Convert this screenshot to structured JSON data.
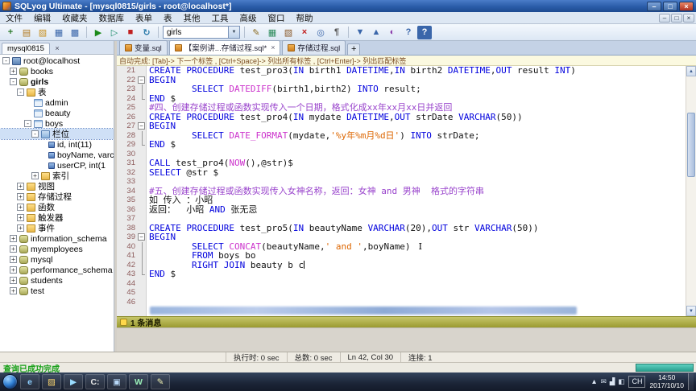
{
  "glyphs": {
    "min": "–",
    "max": "□",
    "close": "×",
    "dropdown": "▼",
    "up": "▲",
    "down": "▼",
    "fold_minus": "−"
  },
  "window": {
    "title": "SQLyog Ultimate - [mysql0815/girls - root@localhost*]"
  },
  "menubar": {
    "items": [
      "文件",
      "编辑",
      "收藏夹",
      "数据库",
      "表单",
      "表",
      "其他",
      "工具",
      "高级",
      "窗口",
      "帮助"
    ]
  },
  "toolbar": {
    "db_value": "girls",
    "items": [
      {
        "name": "new-connection-icon",
        "g": "+",
        "c": "#2a7a2a"
      },
      {
        "name": "new-query-editor-icon",
        "g": "▤",
        "c": "#b07820"
      },
      {
        "name": "open-file-icon",
        "g": "▨",
        "c": "#c89020"
      },
      {
        "name": "save-file-icon",
        "g": "▦",
        "c": "#3a66aa"
      },
      {
        "name": "save-all-icon",
        "g": "▩",
        "c": "#3a66aa"
      },
      {
        "sep": true
      },
      {
        "name": "execute-query-icon",
        "g": "▶",
        "c": "#1a8a1a"
      },
      {
        "name": "explain-query-icon",
        "g": "▷",
        "c": "#1a8a6a"
      },
      {
        "name": "stop-query-icon",
        "g": "■",
        "c": "#c02020"
      },
      {
        "name": "refresh-icon",
        "g": "↻",
        "c": "#2a7aaa"
      },
      {
        "sep": true
      },
      {
        "combo": true
      },
      {
        "sep": true
      },
      {
        "name": "insert-update-icon",
        "g": "✎",
        "c": "#8a6a20"
      },
      {
        "name": "new-table-icon",
        "g": "▦",
        "c": "#2a8a5a"
      },
      {
        "name": "alter-table-icon",
        "g": "▧",
        "c": "#8a5a2a"
      },
      {
        "name": "delete-icon",
        "g": "×",
        "c": "#c02020"
      },
      {
        "name": "find-icon",
        "g": "◎",
        "c": "#3a66aa"
      },
      {
        "name": "format-query-icon",
        "g": "¶",
        "c": "#555555"
      },
      {
        "sep": true
      },
      {
        "name": "export-icon",
        "g": "▼",
        "c": "#3a66aa"
      },
      {
        "name": "import-icon",
        "g": "▲",
        "c": "#3a66aa"
      },
      {
        "name": "scheduler-icon",
        "g": "◐",
        "c": "#8a3aaa"
      },
      {
        "name": "info-icon",
        "g": "?",
        "c": "#3a66aa"
      },
      {
        "name": "help-icon",
        "g": "?",
        "c": "#ffffff",
        "bg": "#3a66aa"
      }
    ]
  },
  "sidebar": {
    "tab_label": "mysql0815",
    "tree": [
      {
        "d": 0,
        "x": "-",
        "i": "server",
        "l": "root@localhost"
      },
      {
        "d": 1,
        "x": "+",
        "i": "db",
        "l": "books"
      },
      {
        "d": 1,
        "x": "-",
        "i": "db",
        "l": "girls",
        "b": 1
      },
      {
        "d": 2,
        "x": "-",
        "i": "folder",
        "l": "表"
      },
      {
        "d": 3,
        "x": "",
        "i": "table",
        "l": "admin"
      },
      {
        "d": 3,
        "x": "",
        "i": "table",
        "l": "beauty"
      },
      {
        "d": 3,
        "x": "-",
        "i": "table",
        "l": "boys"
      },
      {
        "d": 4,
        "x": "-",
        "i": "columns",
        "l": "栏位",
        "sel": 1
      },
      {
        "d": 5,
        "x": "",
        "i": "column",
        "l": "id, int(11)"
      },
      {
        "d": 5,
        "x": "",
        "i": "column",
        "l": "boyName, varch"
      },
      {
        "d": 5,
        "x": "",
        "i": "column",
        "l": "userCP, int(1"
      },
      {
        "d": 4,
        "x": "+",
        "i": "folder",
        "l": "索引"
      },
      {
        "d": 2,
        "x": "+",
        "i": "folder",
        "l": "视图"
      },
      {
        "d": 2,
        "x": "+",
        "i": "folder",
        "l": "存储过程"
      },
      {
        "d": 2,
        "x": "+",
        "i": "folder",
        "l": "函数"
      },
      {
        "d": 2,
        "x": "+",
        "i": "folder",
        "l": "触发器"
      },
      {
        "d": 2,
        "x": "+",
        "i": "folder",
        "l": "事件"
      },
      {
        "d": 1,
        "x": "+",
        "i": "db",
        "l": "information_schema"
      },
      {
        "d": 1,
        "x": "+",
        "i": "db",
        "l": "myemployees"
      },
      {
        "d": 1,
        "x": "+",
        "i": "db",
        "l": "mysql"
      },
      {
        "d": 1,
        "x": "+",
        "i": "db",
        "l": "performance_schema"
      },
      {
        "d": 1,
        "x": "+",
        "i": "db",
        "l": "students"
      },
      {
        "d": 1,
        "x": "+",
        "i": "db",
        "l": "test"
      }
    ]
  },
  "editor": {
    "tabs": [
      {
        "label": "变量.sql",
        "active": false
      },
      {
        "label": "【案例讲...存储过程.sql*",
        "active": true
      },
      {
        "label": "存储过程.sql",
        "active": false
      }
    ],
    "new_tab_label": "+",
    "hint": "自动完成: [Tab]-> 下一个标签 , [Ctrl+Space]-> 列出所有标签 , [Ctrl+Enter]-> 列出匹配标签",
    "lines": [
      {
        "n": 21,
        "t": [
          [
            "k",
            "CREATE PROCEDURE"
          ],
          [
            "t",
            " test_pro3("
          ],
          [
            "k",
            "IN"
          ],
          [
            "t",
            " birth1 "
          ],
          [
            "k",
            "DATETIME"
          ],
          [
            "t",
            ","
          ],
          [
            "k",
            "IN"
          ],
          [
            "t",
            " birth2 "
          ],
          [
            "k",
            "DATETIME"
          ],
          [
            "t",
            ","
          ],
          [
            "k",
            "OUT"
          ],
          [
            "t",
            " result "
          ],
          [
            "k",
            "INT"
          ],
          [
            "t",
            ")"
          ]
        ]
      },
      {
        "n": 22,
        "f": "b",
        "t": [
          [
            "k",
            "BEGIN"
          ]
        ]
      },
      {
        "n": 23,
        "f": "m",
        "t": [
          [
            "t",
            "        "
          ],
          [
            "k",
            "SELECT"
          ],
          [
            "t",
            " "
          ],
          [
            "fn",
            "DATEDIFF"
          ],
          [
            "t",
            "(birth1,birth2) "
          ],
          [
            "k",
            "INTO"
          ],
          [
            "t",
            " result;"
          ]
        ]
      },
      {
        "n": 24,
        "f": "e",
        "t": [
          [
            "k",
            "END"
          ],
          [
            "t",
            " $"
          ]
        ]
      },
      {
        "n": 25,
        "t": [
          [
            "c",
            "#四、创建存储过程或函数实现传入一个日期，格式化成xx年xx月xx日并返回"
          ]
        ]
      },
      {
        "n": 26,
        "t": [
          [
            "k",
            "CREATE PROCEDURE"
          ],
          [
            "t",
            " test_pro4("
          ],
          [
            "k",
            "IN"
          ],
          [
            "t",
            " mydate "
          ],
          [
            "k",
            "DATETIME"
          ],
          [
            "t",
            ","
          ],
          [
            "k",
            "OUT"
          ],
          [
            "t",
            " strDate "
          ],
          [
            "k",
            "VARCHAR"
          ],
          [
            "t",
            "(50))"
          ]
        ]
      },
      {
        "n": 27,
        "f": "b",
        "t": [
          [
            "k",
            "BEGIN"
          ]
        ]
      },
      {
        "n": 28,
        "f": "m",
        "t": [
          [
            "t",
            "        "
          ],
          [
            "k",
            "SELECT"
          ],
          [
            "t",
            " "
          ],
          [
            "fn",
            "DATE_FORMAT"
          ],
          [
            "t",
            "(mydate,"
          ],
          [
            "s",
            "'%y年%m月%d日'"
          ],
          [
            "t",
            ") "
          ],
          [
            "k",
            "INTO"
          ],
          [
            "t",
            " strDate;"
          ]
        ]
      },
      {
        "n": 29,
        "f": "e",
        "t": [
          [
            "k",
            "END"
          ],
          [
            "t",
            " $"
          ]
        ]
      },
      {
        "n": 30,
        "t": []
      },
      {
        "n": 31,
        "t": [
          [
            "k",
            "CALL"
          ],
          [
            "t",
            " test_pro4("
          ],
          [
            "fn",
            "NOW"
          ],
          [
            "t",
            "(),@str)$"
          ]
        ]
      },
      {
        "n": 32,
        "t": [
          [
            "k",
            "SELECT"
          ],
          [
            "t",
            " @str $"
          ]
        ]
      },
      {
        "n": 33,
        "t": []
      },
      {
        "n": 34,
        "t": [
          [
            "c",
            "#五、创建存储过程或函数实现传入女神名称，返回：女神 and 男神  格式的字符串"
          ]
        ]
      },
      {
        "n": 35,
        "t": [
          [
            "t",
            "如 传入 ：小昭"
          ]
        ]
      },
      {
        "n": 36,
        "t": [
          [
            "t",
            "返回：  小昭 "
          ],
          [
            "k",
            "AND"
          ],
          [
            "t",
            " 张无忌"
          ]
        ]
      },
      {
        "n": 37,
        "t": []
      },
      {
        "n": 38,
        "t": [
          [
            "k",
            "CREATE PROCEDURE"
          ],
          [
            "t",
            " test_pro5("
          ],
          [
            "k",
            "IN"
          ],
          [
            "t",
            " beautyName "
          ],
          [
            "k",
            "VARCHAR"
          ],
          [
            "t",
            "(20),"
          ],
          [
            "k",
            "OUT"
          ],
          [
            "t",
            " str "
          ],
          [
            "k",
            "VARCHAR"
          ],
          [
            "t",
            "(50))"
          ]
        ]
      },
      {
        "n": 39,
        "f": "b",
        "t": [
          [
            "k",
            "BEGIN"
          ]
        ]
      },
      {
        "n": 40,
        "f": "m",
        "ibeam": true,
        "t": [
          [
            "t",
            "        "
          ],
          [
            "k",
            "SELECT"
          ],
          [
            "t",
            " "
          ],
          [
            "fn",
            "CONCAT"
          ],
          [
            "t",
            "(beautyName,"
          ],
          [
            "s",
            "' and '"
          ],
          [
            "t",
            ",boyName)"
          ]
        ]
      },
      {
        "n": 41,
        "f": "m",
        "t": [
          [
            "t",
            "        "
          ],
          [
            "k",
            "FROM"
          ],
          [
            "t",
            " boys bo"
          ]
        ]
      },
      {
        "n": 42,
        "f": "m",
        "caret": true,
        "t": [
          [
            "t",
            "        "
          ],
          [
            "k",
            "RIGHT JOIN"
          ],
          [
            "t",
            " beauty b c"
          ]
        ]
      },
      {
        "n": 43,
        "f": "e",
        "t": [
          [
            "k",
            "END"
          ],
          [
            "t",
            " $"
          ]
        ]
      },
      {
        "n": 44,
        "t": []
      },
      {
        "n": 45,
        "t": []
      },
      {
        "n": 46,
        "t": []
      }
    ]
  },
  "messages": {
    "header": "1 条消息"
  },
  "statusbar": {
    "exec_time": "执行时: 0 sec",
    "total_time": "总数: 0 sec",
    "cursor_pos": "Ln 42, Col 30",
    "connections": "连接: 1"
  },
  "footer": {
    "status_text": "查询已成功完成"
  },
  "taskbar": {
    "lang": "CH",
    "time": "14:50",
    "date": "2017/10/10",
    "items": [
      {
        "name": "taskbar-ie-icon",
        "g": "e",
        "c": "#8ed0ff"
      },
      {
        "name": "taskbar-explorer-icon",
        "g": "▨",
        "c": "#ffd870"
      },
      {
        "name": "taskbar-media-player-icon",
        "g": "▶",
        "c": "#9adcff"
      },
      {
        "name": "taskbar-cmd-icon",
        "g": "C:",
        "c": "#e8e8e8"
      },
      {
        "name": "taskbar-editor-icon",
        "g": "▣",
        "c": "#b8d8f8"
      },
      {
        "name": "taskbar-wps-icon",
        "g": "W",
        "c": "#9af0b8"
      },
      {
        "name": "taskbar-notepad-icon",
        "g": "✎",
        "c": "#f0f0b0"
      }
    ],
    "tray": [
      {
        "name": "tray-show-hidden-icon",
        "g": "▲"
      },
      {
        "name": "tray-message-icon",
        "g": "✉"
      },
      {
        "name": "tray-network-icon",
        "g": "▟"
      },
      {
        "name": "tray-volume-icon",
        "g": "◧"
      }
    ]
  }
}
